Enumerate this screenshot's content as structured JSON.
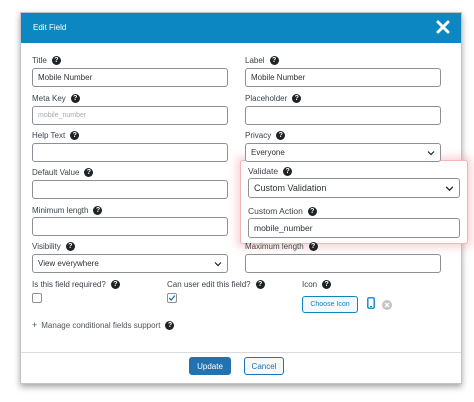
{
  "dialog": {
    "title": "Edit Field",
    "close_icon": "close-icon"
  },
  "fields": {
    "title": {
      "label": "Title",
      "value": "Mobile Number"
    },
    "label": {
      "label": "Label",
      "value": "Mobile Number"
    },
    "meta_key": {
      "label": "Meta Key",
      "placeholder": "mobile_number"
    },
    "placeholder": {
      "label": "Placeholder",
      "value": ""
    },
    "help_text": {
      "label": "Help Text",
      "value": ""
    },
    "privacy": {
      "label": "Privacy",
      "selected": "Everyone"
    },
    "default_value": {
      "label": "Default Value",
      "value": ""
    },
    "validate": {
      "label": "Validate",
      "selected": "Custom Validation"
    },
    "minimum_length": {
      "label": "Minimum length",
      "value": ""
    },
    "custom_action": {
      "label": "Custom Action",
      "value": "mobile_number"
    },
    "visibility": {
      "label": "Visibility",
      "selected": "View everywhere"
    },
    "maximum_length": {
      "label": "Maximum length",
      "value": ""
    },
    "required": {
      "label": "Is this field required?",
      "checked": false
    },
    "user_editable": {
      "label": "Can user edit this field?",
      "checked": true
    },
    "icon": {
      "label": "Icon",
      "choose_label": "Choose Icon",
      "icon_name": "mobile-phone-icon"
    }
  },
  "conditional": {
    "label": "Manage conditional fields support"
  },
  "footer": {
    "update_label": "Update",
    "cancel_label": "Cancel"
  },
  "colors": {
    "header": "#0d87c1",
    "primary": "#2271b1",
    "highlight": "#f08c8c"
  }
}
